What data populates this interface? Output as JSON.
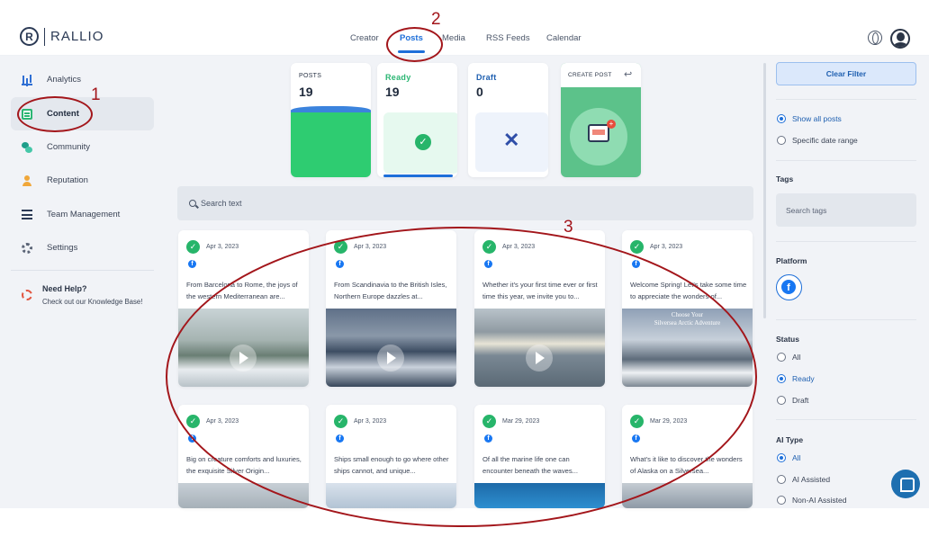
{
  "app": {
    "brand_letter": "R",
    "brand": "RALLIO"
  },
  "topnav": {
    "creator": "Creator",
    "posts": "Posts",
    "media": "Media",
    "rss": "RSS Feeds",
    "calendar": "Calendar"
  },
  "sidebar": {
    "analytics": "Analytics",
    "content": "Content",
    "community": "Community",
    "reputation": "Reputation",
    "team": "Team Management",
    "settings": "Settings",
    "help_title": "Need Help?",
    "help_sub": "Check out our Knowledge Base!"
  },
  "stats": {
    "posts_label": "POSTS",
    "posts_value": "19",
    "ready_label": "Ready",
    "ready_value": "19",
    "draft_label": "Draft",
    "draft_value": "0",
    "create_label": "CREATE POST"
  },
  "search": {
    "placeholder": "Search text"
  },
  "posts": [
    {
      "date": "Apr 3, 2023",
      "text": "From Barcelona to Rome, the joys of the western Mediterranean are..."
    },
    {
      "date": "Apr 3, 2023",
      "text": "From Scandinavia to the British Isles, Northern Europe dazzles at..."
    },
    {
      "date": "Apr 3, 2023",
      "text": "Whether it's your first time ever or first time this year, we invite you to..."
    },
    {
      "date": "Apr 3, 2023",
      "text": "Welcome Spring! Let's take some time to appreciate the wonders of...",
      "image_caption_1": "Choose Your",
      "image_caption_2": "Silversea Arctic Adventure"
    },
    {
      "date": "Apr 3, 2023",
      "text": "Big on creature comforts and luxuries, the exquisite Silver Origin..."
    },
    {
      "date": "Apr 3, 2023",
      "text": "Ships small enough to go where other ships cannot, and unique..."
    },
    {
      "date": "Mar 29, 2023",
      "text": "Of all the marine life one can encounter beneath the waves..."
    },
    {
      "date": "Mar 29, 2023",
      "text": "What's it like to discover the wonders of Alaska on a Silversea..."
    }
  ],
  "filters": {
    "clear_label": "Clear Filter",
    "show_all": "Show all posts",
    "date_range": "Specific date range",
    "tags_title": "Tags",
    "tags_placeholder": "Search tags",
    "platform_title": "Platform",
    "status_title": "Status",
    "status_all": "All",
    "status_ready": "Ready",
    "status_draft": "Draft",
    "ai_title": "AI Type",
    "ai_all": "All",
    "ai_assisted": "AI Assisted",
    "ai_non": "Non-AI Assisted"
  },
  "annotations": {
    "one": "1",
    "two": "2",
    "three": "3",
    "color": "#a3161b"
  },
  "colors": {
    "accent": "#1e6fd9",
    "ready_green": "#27b56a",
    "posts_green": "#2ecc71"
  }
}
